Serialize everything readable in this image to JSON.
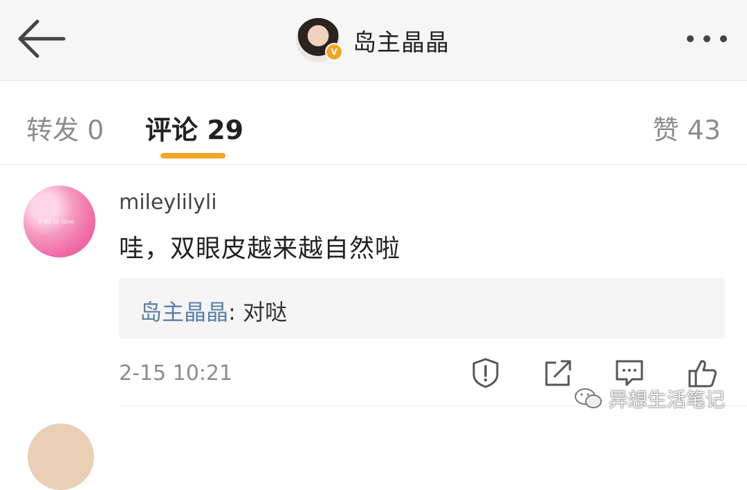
{
  "header": {
    "title": "岛主晶晶",
    "verified_badge": "V",
    "back_icon": "arrow-left-icon",
    "more_icon": "more-dots-icon"
  },
  "tabs": {
    "reposts": "转发 0",
    "comments": "评论 29",
    "likes": "赞 43"
  },
  "comment": {
    "username": "mileylilyli",
    "avatar_text": "Full to love",
    "text": "哇，双眼皮越来越自然啦",
    "reply": {
      "author": "岛主晶晶",
      "separator": ": ",
      "text": "对哒"
    },
    "timestamp": "2-15 10:21",
    "actions": [
      "report-icon",
      "share-icon",
      "reply-icon",
      "like-icon"
    ]
  },
  "watermark": {
    "text": "异想生活笔记",
    "icon": "wechat-icon"
  },
  "colors": {
    "accent": "#f4a623",
    "reply_author": "#5a7fa8",
    "header_bg": "#f6f6f6"
  }
}
